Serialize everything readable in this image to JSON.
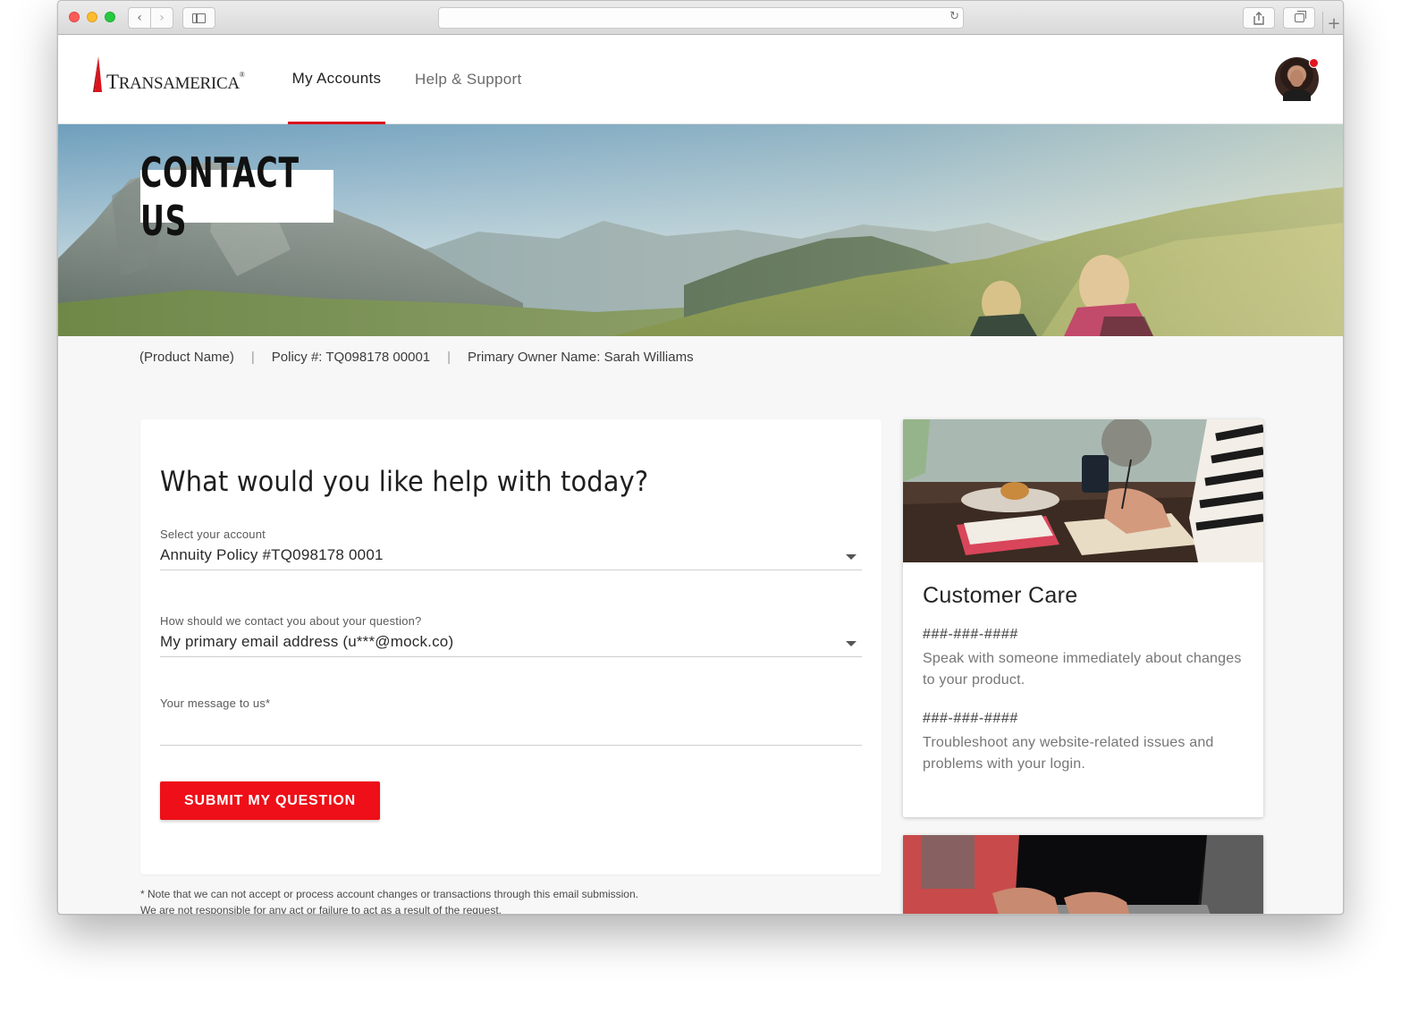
{
  "browser": {
    "url": "",
    "icons": {
      "back": "chevron-left-icon",
      "forward": "chevron-right-icon",
      "sidebar": "sidebar-icon",
      "reload": "reload-icon",
      "share": "share-icon",
      "tabs": "tabs-icon",
      "new_tab": "plus-icon"
    }
  },
  "header": {
    "logo_text": "Transamerica",
    "nav": [
      {
        "label": "My Accounts",
        "active": true
      },
      {
        "label": "Help & Support",
        "active": false
      }
    ],
    "avatar_has_notification": true
  },
  "hero": {
    "title": "CONTACT US"
  },
  "policy_bar": {
    "product": "(Product Name)",
    "policy": "Policy #: TQ098178 00001",
    "owner": "Primary Owner Name: Sarah Williams",
    "separator": "|"
  },
  "form": {
    "heading": "What would you like help with today?",
    "account_label": "Select your account",
    "account_value": "Annuity Policy #TQ098178 0001",
    "contact_label": "How should we contact you about your question?",
    "contact_value": "My primary email address (u***@mock.co)",
    "message_label": "Your message to us*",
    "message_value": "",
    "submit_label": "SUBMIT MY QUESTION"
  },
  "disclaimer": {
    "line1": "* Note that we can not accept or process account changes or transactions through this email submission.",
    "line2": "We are not responsible for any act or failure to act as a result of the request."
  },
  "customer_care": {
    "title": "Customer Care",
    "contacts": [
      {
        "phone": "###-###-####",
        "description": "Speak with someone immediately about changes to your product."
      },
      {
        "phone": "###-###-####",
        "description": "Troubleshoot any website-related issues and problems with your login."
      }
    ]
  },
  "colors": {
    "brand_red": "#ee0f18",
    "nav_underline": "#d9141c",
    "page_bg": "#f7f7f7"
  }
}
